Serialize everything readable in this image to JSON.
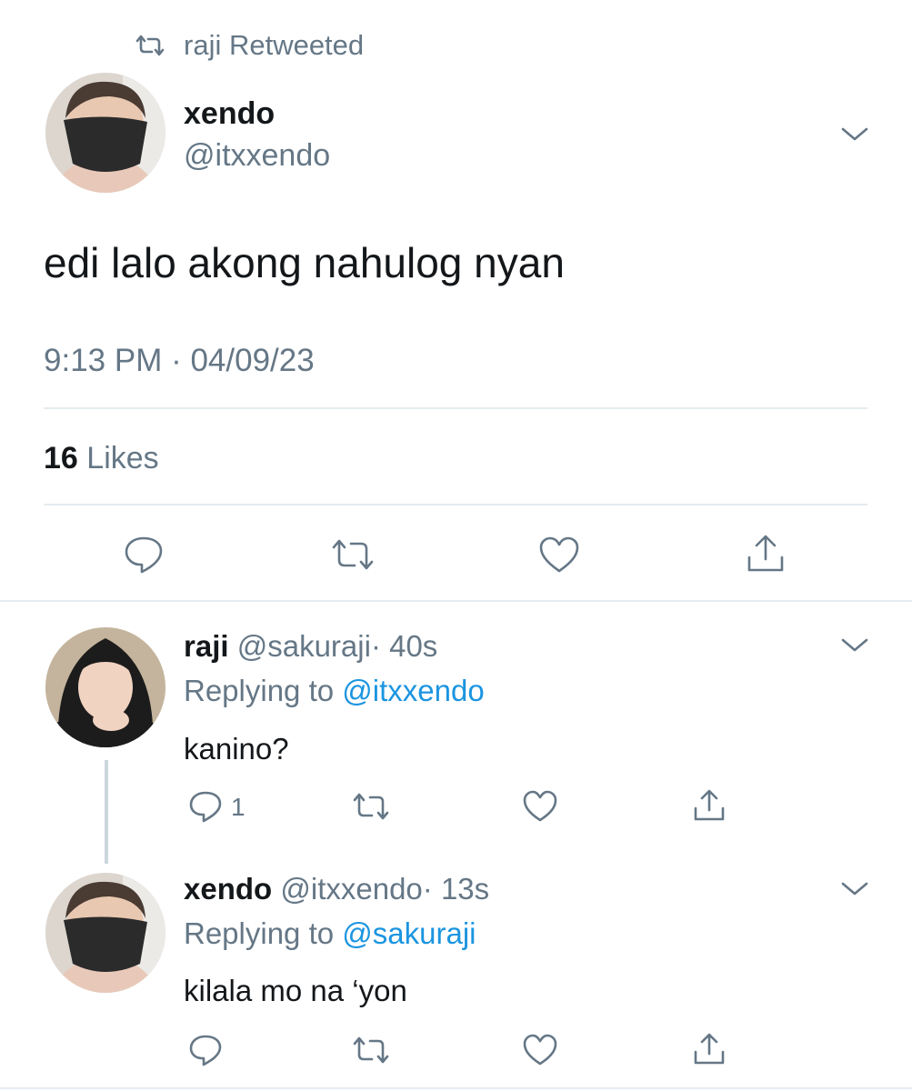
{
  "retweet_context": {
    "label": "raji Retweeted",
    "icon": "retweet-icon"
  },
  "main_tweet": {
    "display_name": "xendo",
    "handle": "@itxxendo",
    "text": "edi lalo akong nahulog nyan",
    "timestamp": "9:13 PM · 04/09/23",
    "likes_count": "16",
    "likes_label": "Likes",
    "actions": [
      "reply-icon",
      "retweet-icon",
      "like-icon",
      "share-icon"
    ]
  },
  "replies": [
    {
      "display_name": "raji",
      "handle": "@sakuraji",
      "time": "· 40s",
      "replying_label": "Replying to",
      "replying_to": "@itxxendo",
      "text": "kanino?",
      "reply_count": "1"
    },
    {
      "display_name": "xendo",
      "handle": "@itxxendo",
      "time": "· 13s",
      "replying_label": "Replying to",
      "replying_to": "@sakuraji",
      "text": "kilala mo na ‘yon",
      "reply_count": ""
    }
  ],
  "colors": {
    "link": "#1b95e0",
    "muted": "#657786",
    "divider": "#e6ecf0",
    "text": "#14171a"
  }
}
